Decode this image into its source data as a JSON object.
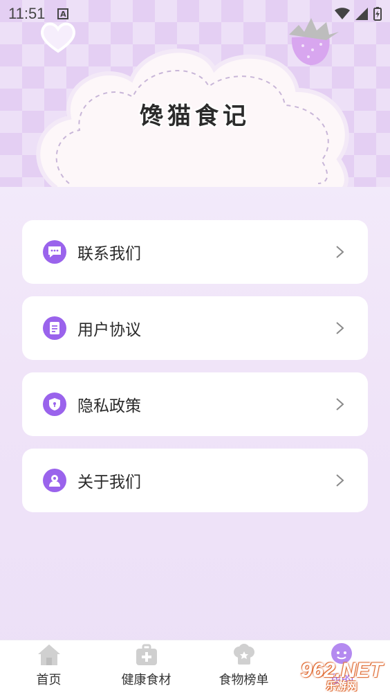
{
  "status_bar": {
    "time": "11:51",
    "indicator": "A"
  },
  "app": {
    "title": "馋猫食记"
  },
  "menu": [
    {
      "label": "联系我们",
      "icon": "chat-icon"
    },
    {
      "label": "用户协议",
      "icon": "document-icon"
    },
    {
      "label": "隐私政策",
      "icon": "shield-icon"
    },
    {
      "label": "关于我们",
      "icon": "people-icon"
    }
  ],
  "tabs": [
    {
      "label": "首页",
      "icon": "home-icon"
    },
    {
      "label": "健康食材",
      "icon": "medkit-icon"
    },
    {
      "label": "食物榜单",
      "icon": "chef-hat-icon"
    },
    {
      "label": "我的",
      "icon": "profile-icon",
      "active": true
    }
  ],
  "watermark": {
    "brand": "962.NET",
    "sub": "乐游网"
  },
  "colors": {
    "accent": "#9a63ec",
    "header_bg": "#e4cff3",
    "page_bg": "#f2e8fa"
  }
}
